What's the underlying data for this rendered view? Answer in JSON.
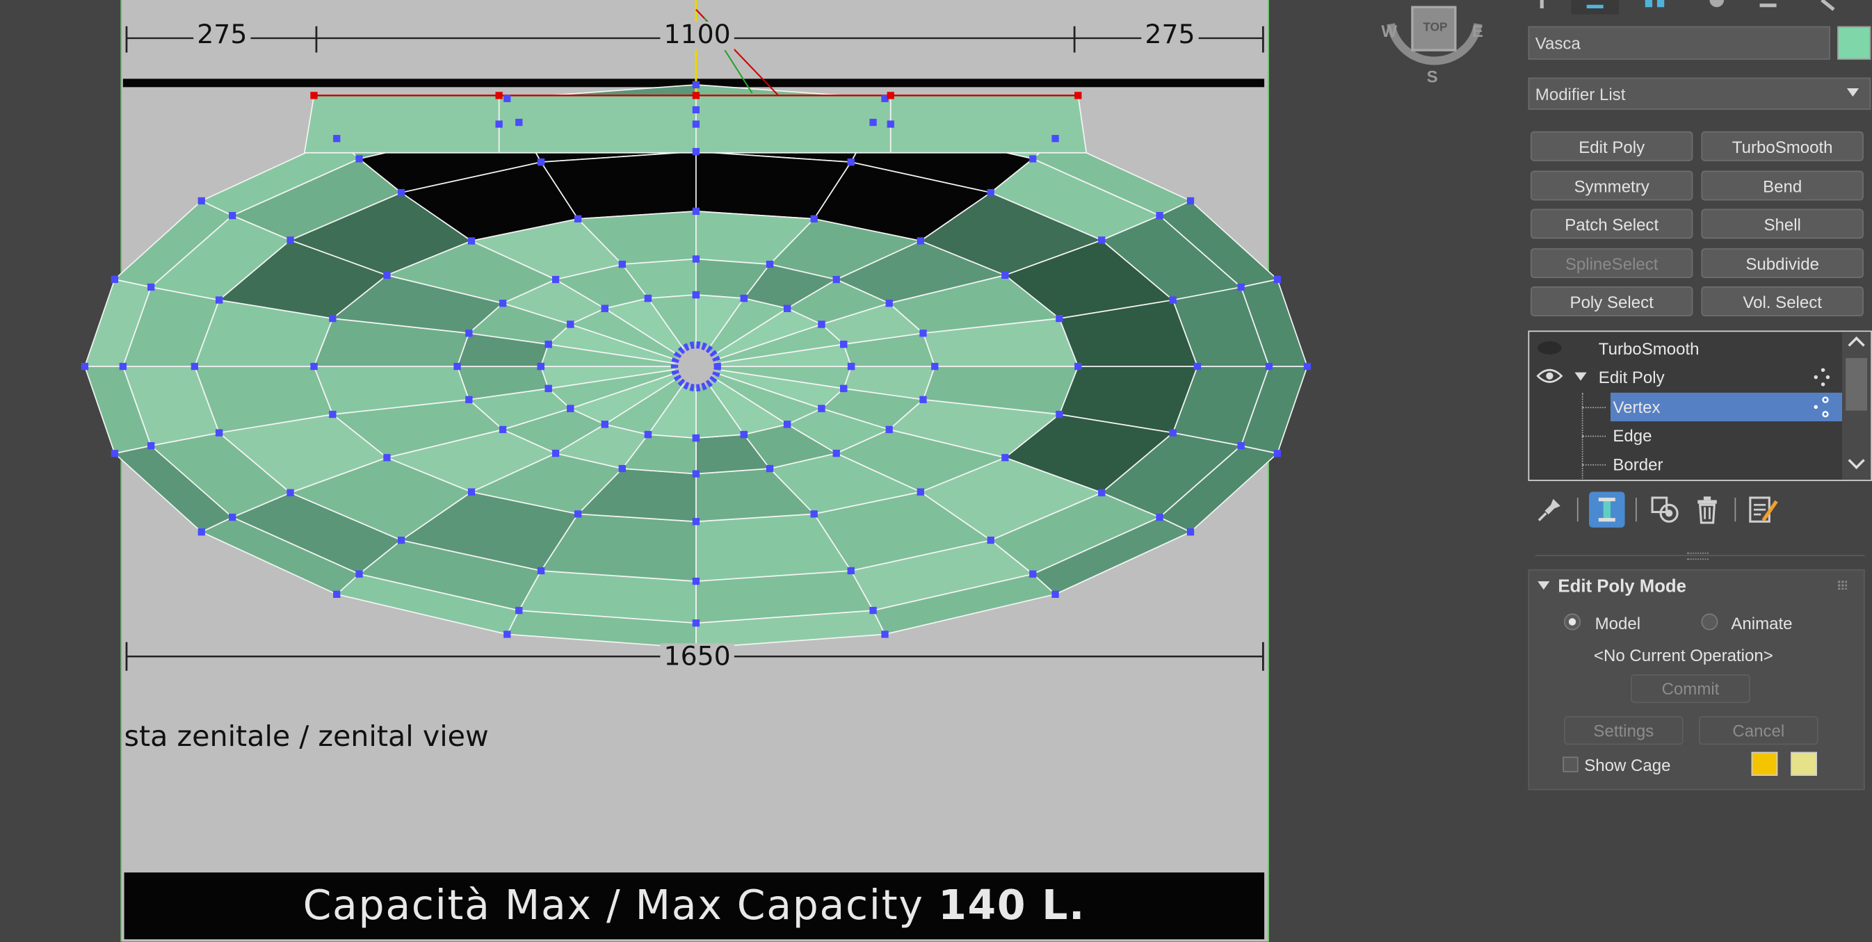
{
  "viewport": {
    "dimensions": {
      "left": "275",
      "center": "1100",
      "right": "275",
      "bottom": "1650"
    },
    "view_caption": "sta zenitale / zenital view",
    "capacity": {
      "text": "Capacità Max / Max Capacity",
      "value": "140 L."
    },
    "viewcube": {
      "top": "TOP",
      "west": "W",
      "east": "E",
      "south": "S"
    },
    "colors": {
      "mesh": "#7fbf98",
      "vertex": "#4a4aff",
      "selected_vertex": "#e00000",
      "background": "#bebebe"
    }
  },
  "panel": {
    "object_name": "Vasca",
    "object_color": "#7fd6a8",
    "modifier_list": "Modifier List",
    "modifier_buttons": [
      {
        "label": "Edit Poly",
        "enabled": true
      },
      {
        "label": "TurboSmooth",
        "enabled": true
      },
      {
        "label": "Symmetry",
        "enabled": true
      },
      {
        "label": "Bend",
        "enabled": true
      },
      {
        "label": "Patch Select",
        "enabled": true
      },
      {
        "label": "Shell",
        "enabled": true
      },
      {
        "label": "SplineSelect",
        "enabled": false
      },
      {
        "label": "Subdivide",
        "enabled": true
      },
      {
        "label": "Poly Select",
        "enabled": true
      },
      {
        "label": "Vol. Select",
        "enabled": true
      }
    ],
    "stack": [
      {
        "label": "TurboSmooth"
      },
      {
        "label": "Edit Poly"
      },
      {
        "label": "Vertex"
      },
      {
        "label": "Edge"
      },
      {
        "label": "Border"
      }
    ],
    "rollout": {
      "title": "Edit Poly Mode",
      "model": "Model",
      "animate": "Animate",
      "operation": "<No Current Operation>",
      "commit": "Commit",
      "settings": "Settings",
      "cancel": "Cancel",
      "show_cage": "Show Cage",
      "cage_colors": [
        "#f5c400",
        "#e6e28a"
      ]
    }
  }
}
